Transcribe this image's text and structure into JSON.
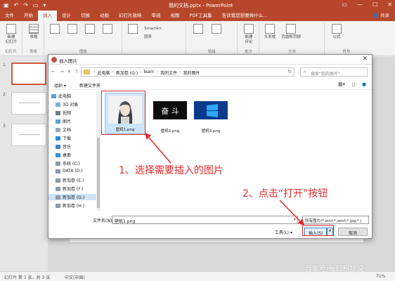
{
  "window": {
    "title": "我的文档.pptx - PowerPoint",
    "share_label": "共享"
  },
  "ribbon_tabs": [
    "文件",
    "开始",
    "插入",
    "设计",
    "切换",
    "动画",
    "幻灯片放映",
    "审阅",
    "视图",
    "PDF工具集",
    "告诉我您想要做什么..."
  ],
  "active_tab_index": 2,
  "ribbon": {
    "new_slide": "新建\n幻灯片",
    "table": "表格",
    "slides_group": "幻灯片",
    "tables_group": "表格",
    "smartart": "SmartArt",
    "chart": "图表",
    "images_group": "图像",
    "links_group": "链接",
    "new_comment": "新建\n评论",
    "comments_group": "批注",
    "textbox": "文本框",
    "header_footer": "页眉和页脚",
    "text_group": "文本",
    "symbols_group": "符号",
    "formula": "公式"
  },
  "slides": [
    "1",
    "2",
    "3"
  ],
  "dialog": {
    "title": "插入图片",
    "close": "✕",
    "breadcrumbs": [
      "此电脑",
      "新加卷 (G:)",
      "learn",
      "我的文件",
      "我的图片"
    ],
    "search_placeholder": "搜索\"我的图片\"",
    "organize": "组织 ▾",
    "new_folder": "新建文件夹",
    "nav_items": [
      "此电脑",
      "3D 对象",
      "视频",
      "图片",
      "文档",
      "下载",
      "音乐",
      "桌面",
      "系统 (C:)",
      "DATA (D:)",
      "新加卷 (E:)",
      "新加卷 (F:)",
      "新加卷 (G:)",
      "新加卷 (H:)"
    ],
    "selected_nav_index": 12,
    "files": [
      {
        "name": "壁纸1.png",
        "selected": true
      },
      {
        "name": "壁纸2.png",
        "selected": false,
        "image_text": "奋 斗"
      },
      {
        "name": "壁纸3.png",
        "selected": false
      }
    ],
    "filename_label": "文件名(N):",
    "filename_value": "壁纸1.png",
    "filetype_value": "所有图片(*.emf;*.wmf;*.jpg;*.j",
    "tools_label": "工具(L)",
    "insert_button": "插入(S)",
    "cancel_button": "取消"
  },
  "annotations": {
    "step1": "1、选择需要插入的图片",
    "step2": "2、点击“打开”按钮",
    "color": "#e32a2a"
  },
  "statusbar": {
    "slide_info": "幻灯片 第 1 张，共 3 张",
    "language": "中文(中国)",
    "zoom": "71%"
  },
  "watermark": "百家号/每日科技说"
}
